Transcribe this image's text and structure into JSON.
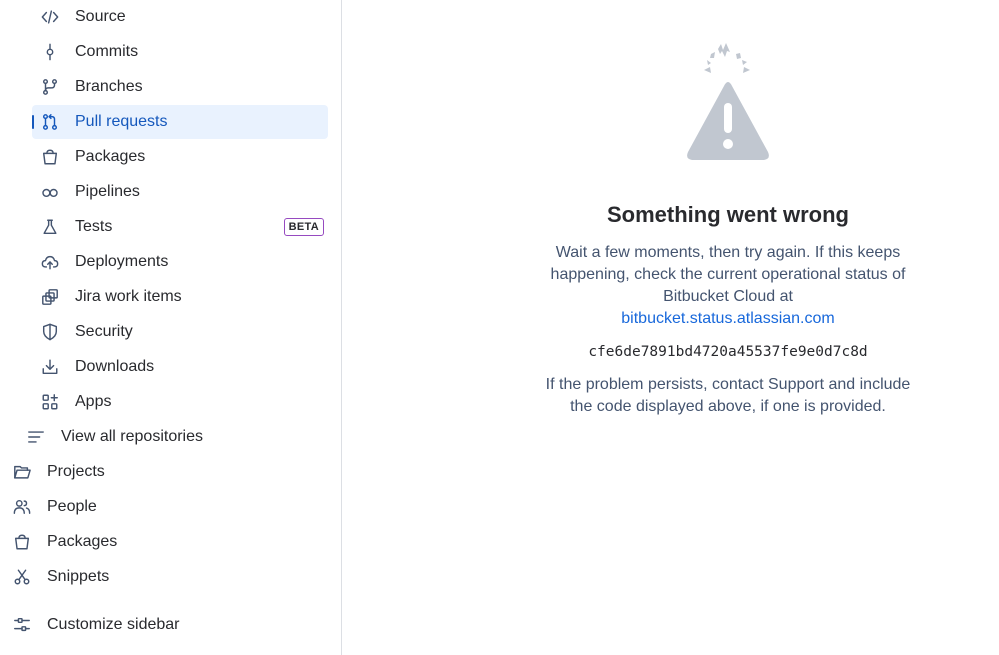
{
  "sidebar": {
    "repo_items": [
      {
        "label": "Source",
        "icon": "code-icon"
      },
      {
        "label": "Commits",
        "icon": "commit-icon"
      },
      {
        "label": "Branches",
        "icon": "branch-icon"
      },
      {
        "label": "Pull requests",
        "icon": "pull-request-icon",
        "selected": true
      },
      {
        "label": "Packages",
        "icon": "package-icon"
      },
      {
        "label": "Pipelines",
        "icon": "pipeline-icon"
      },
      {
        "label": "Tests",
        "icon": "flask-icon",
        "badge": "BETA"
      },
      {
        "label": "Deployments",
        "icon": "cloud-upload-icon"
      },
      {
        "label": "Jira work items",
        "icon": "jira-icon"
      },
      {
        "label": "Security",
        "icon": "shield-icon"
      },
      {
        "label": "Downloads",
        "icon": "download-icon"
      },
      {
        "label": "Apps",
        "icon": "apps-icon"
      }
    ],
    "view_all": {
      "label": "View all repositories",
      "icon": "list-icon"
    },
    "top_items": [
      {
        "label": "Projects",
        "icon": "folder-icon"
      },
      {
        "label": "People",
        "icon": "people-icon"
      },
      {
        "label": "Packages",
        "icon": "package-icon"
      },
      {
        "label": "Snippets",
        "icon": "scissors-icon"
      }
    ],
    "customize": {
      "label": "Customize sidebar",
      "icon": "sliders-icon"
    }
  },
  "error": {
    "title": "Something went wrong",
    "message": "Wait a few moments, then try again. If this keeps happening, check the current operational status of Bitbucket Cloud at",
    "link": "bitbucket.status.atlassian.com",
    "code": "cfe6de7891bd4720a45537fe9e0d7c8d",
    "persist": "If the problem persists, contact Support and include the code displayed above, if one is provided.",
    "illustration_icon": "warning-icon"
  },
  "colors": {
    "accent": "#1558bc",
    "selected_bg": "#e9f2fe",
    "link": "#1868db",
    "badge_border": "#964ac0",
    "illustration": "#c1c7d0"
  }
}
